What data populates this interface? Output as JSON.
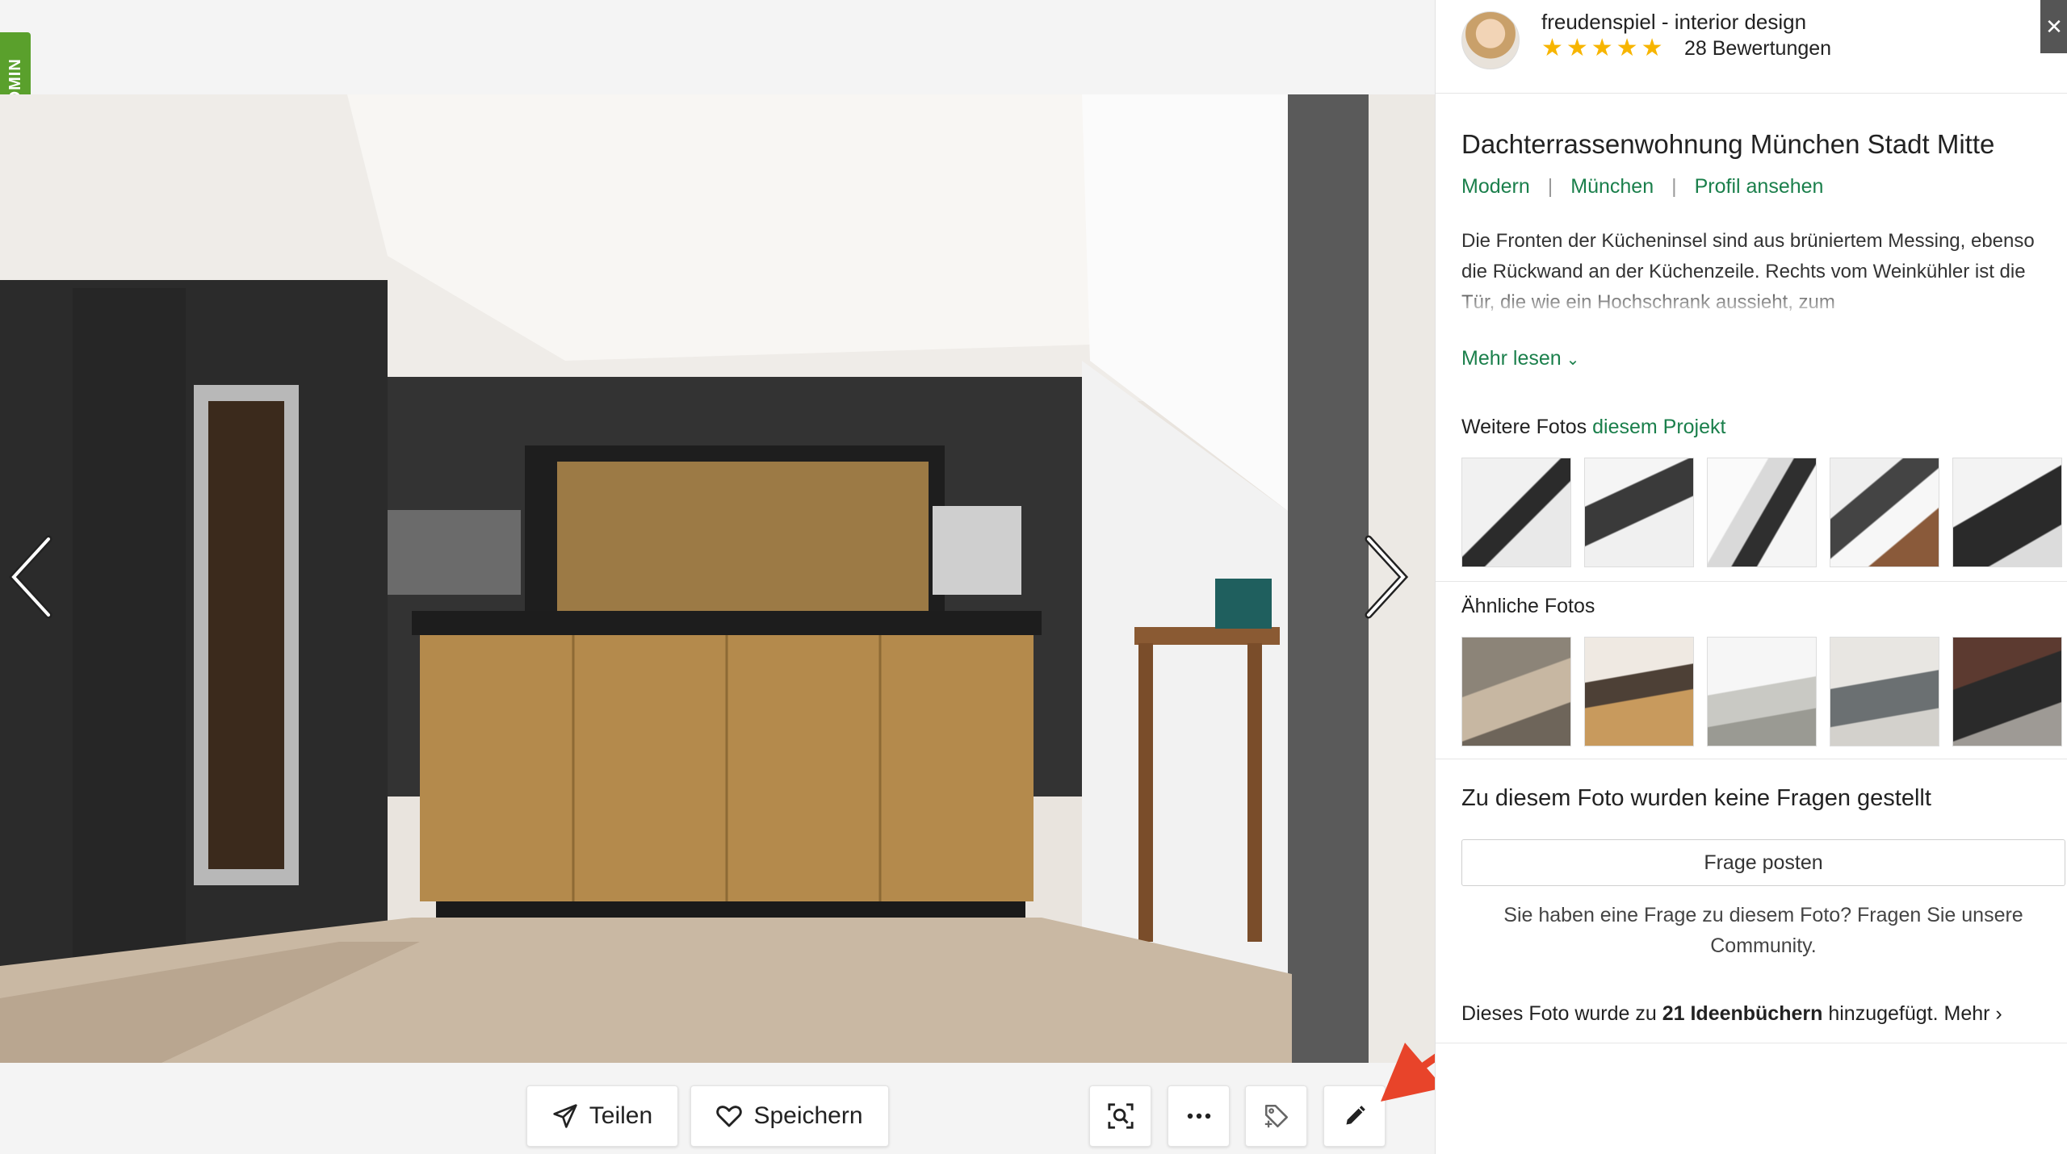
{
  "admin_label": "ADMIN",
  "pro": {
    "name": "freudenspiel - interior design",
    "stars": "★★★★★",
    "reviews": "28 Bewertungen"
  },
  "close_icon": "close-icon",
  "photo": {
    "title": "Dachterrassenwohnung München Stadt Mitte",
    "style": "Modern",
    "city": "München",
    "profile_link": "Profil ansehen",
    "description": "Die Fronten der Kücheninsel sind aus brüniertem Messing, ebenso die Rückwand an der Küchenzeile. Rechts vom Weinkühler ist die Tür, die wie ein Hochschrank aussieht, zum",
    "more": "Mehr lesen"
  },
  "more_photos": {
    "label": "Weitere Fotos",
    "link": "diesem Projekt"
  },
  "similar_photos": {
    "label": "Ähnliche Fotos"
  },
  "questions": {
    "heading": "Zu diesem Foto wurden keine Fragen gestellt",
    "button": "Frage posten",
    "sub": "Sie haben eine Frage zu diesem Foto? Fragen Sie unsere Community."
  },
  "ideabook": {
    "prefix": "Dieses Foto wurde zu ",
    "bold": "21 Ideenbüchern",
    "suffix": " hinzugefügt.",
    "more": "Mehr"
  },
  "toolbar": {
    "share": "Teilen",
    "save": "Speichern"
  },
  "colors": {
    "accent": "#1a7f4b",
    "admin": "#5aa02c",
    "star": "#f7b500",
    "arrow": "#e8442a"
  }
}
